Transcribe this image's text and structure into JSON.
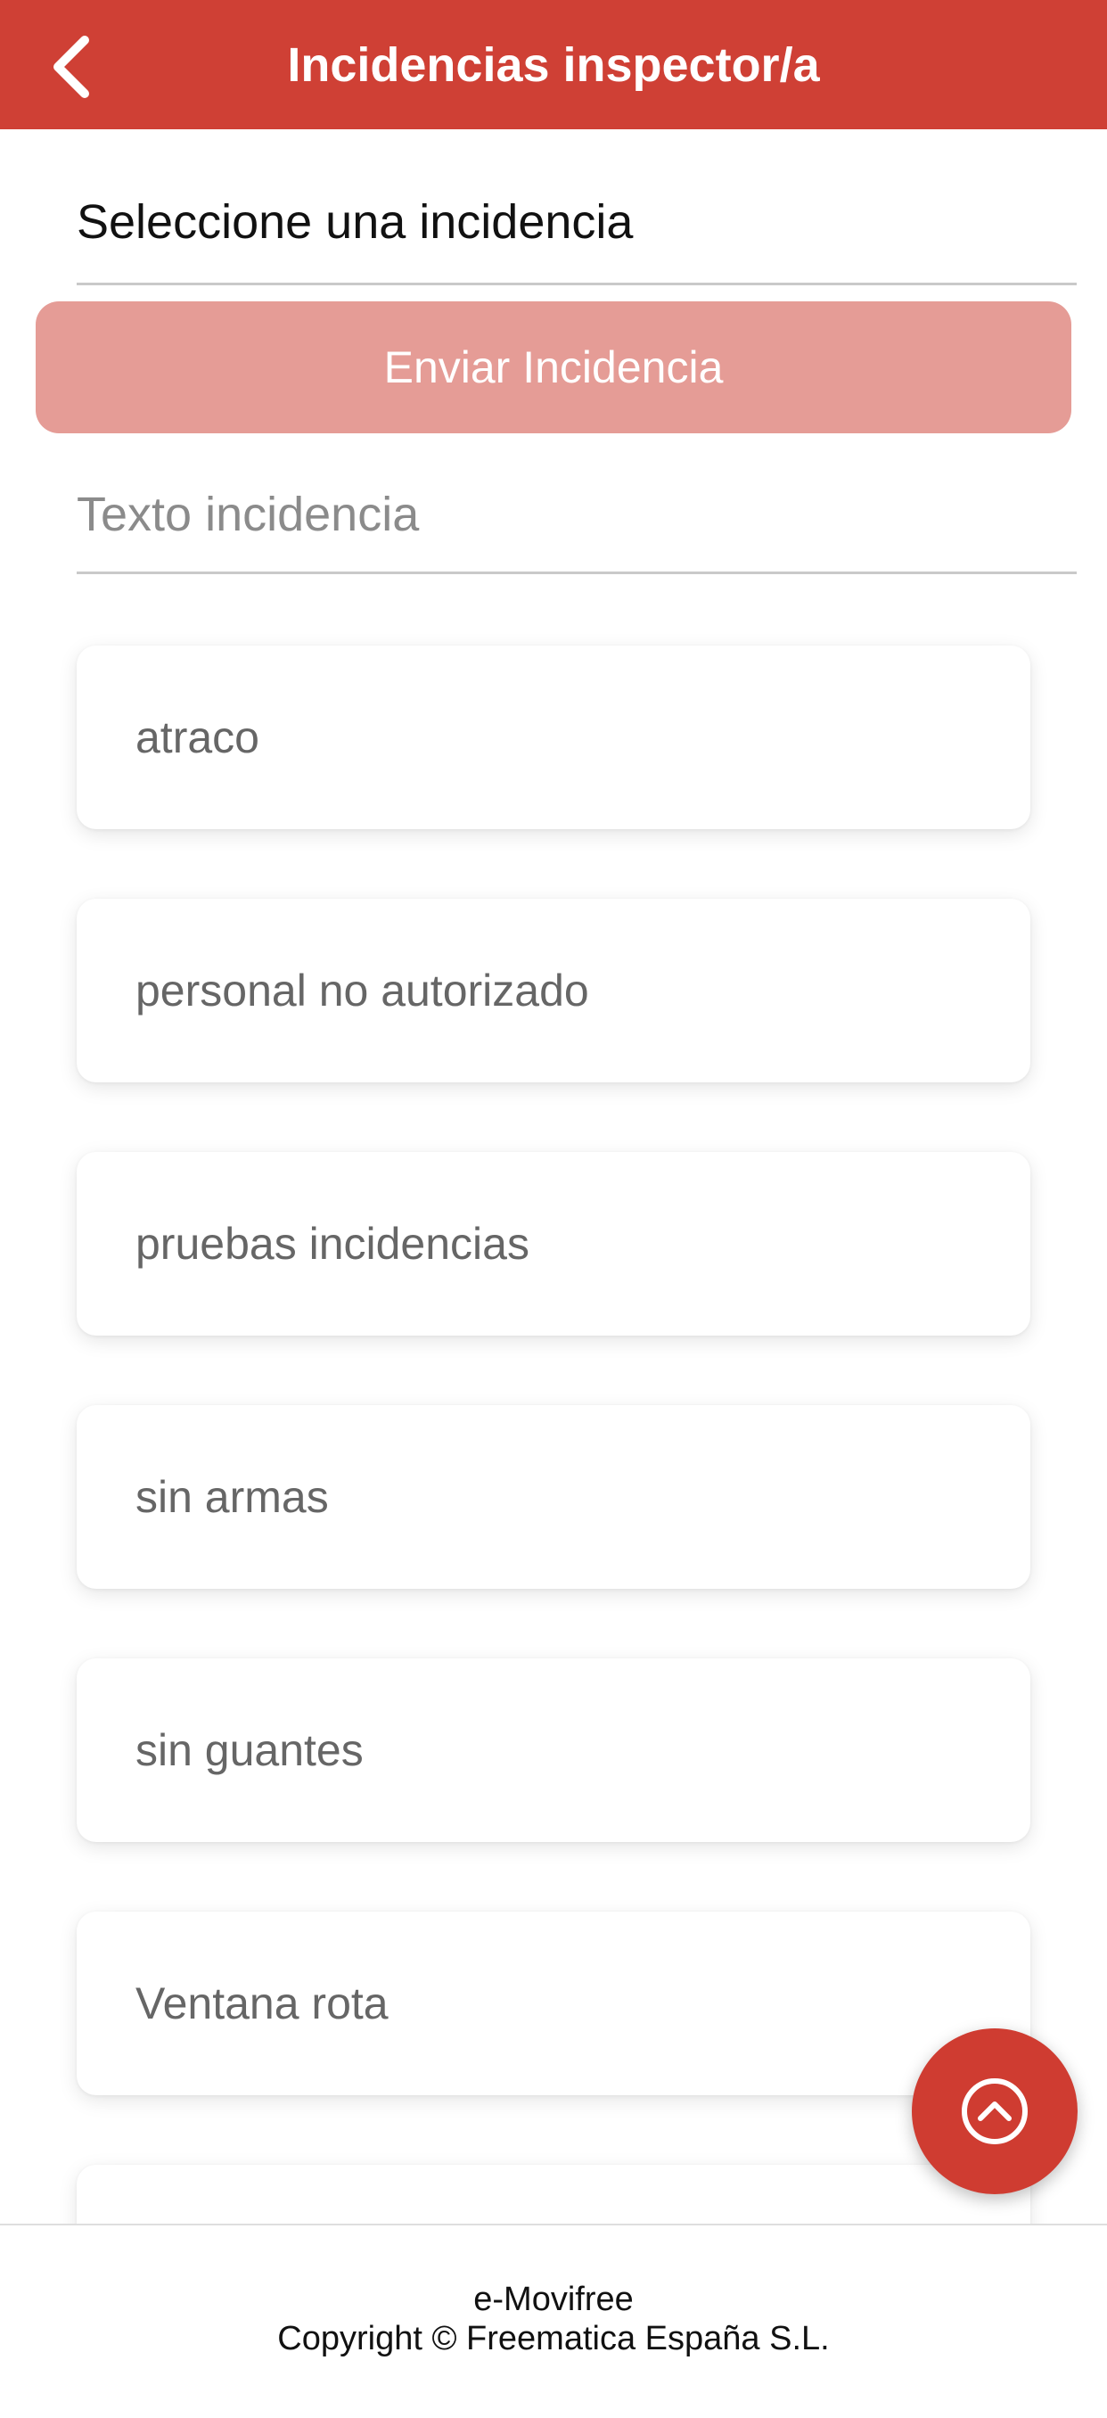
{
  "header": {
    "title": "Incidencias inspector/a",
    "back_icon": "chevron-left-icon",
    "background_color": "#cf4035"
  },
  "form": {
    "select_value": "Seleccione una incidencia",
    "send_button_label": "Enviar Incidencia",
    "send_button_color": "#e59c96",
    "text_placeholder": "Texto incidencia",
    "text_value": ""
  },
  "incidents": [
    {
      "label": "atraco"
    },
    {
      "label": "personal no autorizado"
    },
    {
      "label": "pruebas incidencias"
    },
    {
      "label": "sin armas"
    },
    {
      "label": "sin guantes"
    },
    {
      "label": "Ventana rota"
    },
    {
      "label": ""
    }
  ],
  "fab": {
    "icon": "chevron-up-circle-icon",
    "color": "#cf3c31"
  },
  "footer": {
    "app_name": "e-Movifree",
    "copyright": "Copyright © Freematica España S.L."
  }
}
